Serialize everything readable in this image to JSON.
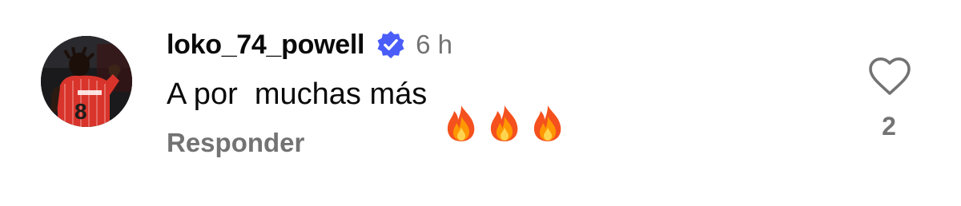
{
  "comment": {
    "username": "loko_74_powell",
    "verified": true,
    "timestamp": "6 h",
    "text": "A por  muchas más ",
    "emoji_count": 3,
    "emoji_icon": "fire-icon",
    "reply_label": "Responder",
    "like_icon": "heart-outline-icon",
    "like_count": "2",
    "avatar_jersey_number": "8"
  },
  "colors": {
    "verified_badge": "#4a5df9",
    "text_primary": "#0a0a0a",
    "text_secondary": "#737373",
    "jersey": "#d9342b"
  }
}
